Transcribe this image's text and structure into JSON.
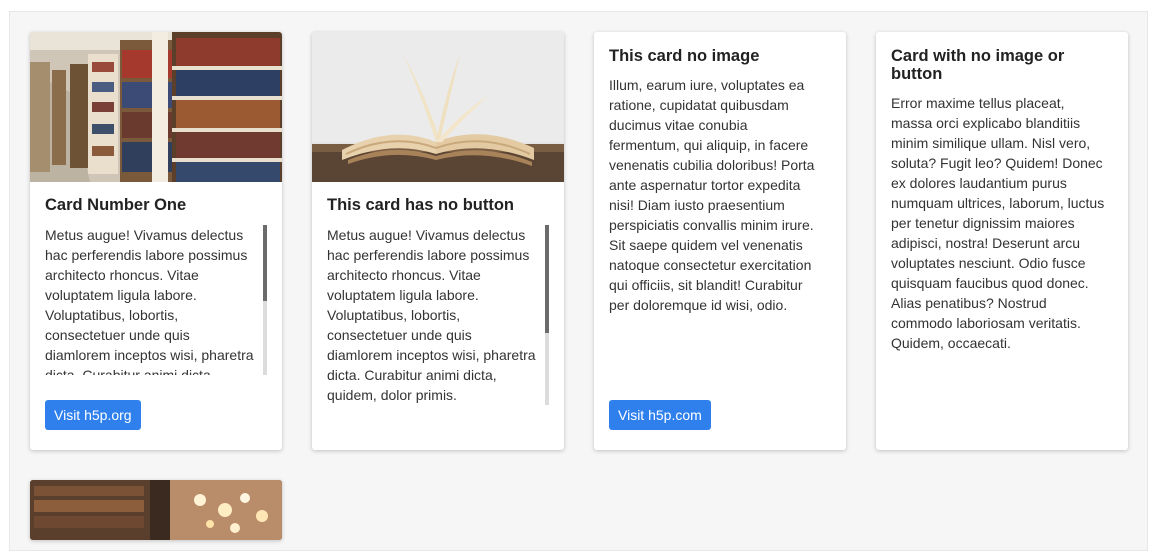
{
  "cards": [
    {
      "title": "Card Number One",
      "text": "Metus augue! Vivamus delectus hac perferendis labore possimus architecto rhoncus. Vitae voluptatem ligula labore. Voluptatibus, lobortis, consectetuer unde quis diamlorem inceptos wisi, pharetra dicta. Curabitur animi dicta, quidem, dolor primis.",
      "button_label": "Visit h5p.org",
      "image": "library-bookshelves-photo"
    },
    {
      "title": "This card has no button",
      "text": "Metus augue! Vivamus delectus hac perferendis labore possimus architecto rhoncus. Vitae voluptatem ligula labore. Voluptatibus, lobortis, consectetuer unde quis diamlorem inceptos wisi, pharetra dicta. Curabitur animi dicta, quidem, dolor primis.",
      "image": "open-book-photo"
    },
    {
      "title": "This card no image",
      "text": "Illum, earum iure, voluptates ea ratione, cupidatat quibusdam ducimus vitae conubia fermentum, qui aliquip, in facere venenatis cubilia doloribus! Porta ante aspernatur tortor expedita nisi! Diam iusto praesentium perspiciatis convallis minim irure. Sit saepe quidem vel venenatis natoque consectetur exercitation qui officiis, sit blandit! Curabitur per doloremque id wisi, odio.",
      "button_label": "Visit h5p.com"
    },
    {
      "title": "Card with no image or button",
      "text": "Error maxime tellus placeat, massa orci explicabo blanditiis minim similique ullam. Nisl vero, soluta? Fugit leo? Quidem! Donec ex dolores laudantium purus numquam ultrices, laborum, luctus per tenetur dignissim maiores adipisci, nostra! Deserunt arcu voluptates nesciunt. Odio fusce quisquam faucibus quod donec. Alias penatibus? Nostrud commodo laboriosam veritatis. Quidem, occaecati."
    },
    {
      "image": "library-bokeh-lights-photo"
    }
  ],
  "colors": {
    "button": "#2f80ed",
    "background": "#f6f6f6",
    "card": "#ffffff"
  }
}
